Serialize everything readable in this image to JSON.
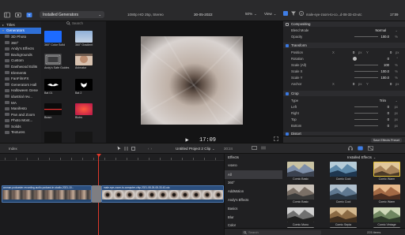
{
  "toolbar": {
    "library_menu": "Installed Generators",
    "format": "1080p HD 25p, Stereo",
    "date": "30-05-2022",
    "zoom": "50%",
    "view": "View",
    "clip_name": "male-eye-zoom-to-co...d-08-33-43-utc",
    "duration": "17:09"
  },
  "sidebar": {
    "items": [
      {
        "label": "Titles",
        "level": 0,
        "expanded": false
      },
      {
        "label": "Generators",
        "level": 0,
        "expanded": true,
        "selected": true
      },
      {
        "label": "3D Photo",
        "level": 1
      },
      {
        "label": "360°",
        "level": 1
      },
      {
        "label": "Andy's Effects",
        "level": 1
      },
      {
        "label": "Backgrounds",
        "level": 1
      },
      {
        "label": "Custom",
        "level": 1
      },
      {
        "label": "Dashwood Edits",
        "level": 1
      },
      {
        "label": "Elements",
        "level": 1
      },
      {
        "label": "FanFilmFX",
        "level": 1
      },
      {
        "label": "Generators Hall",
        "level": 1
      },
      {
        "label": "Halloween Gene",
        "level": 1
      },
      {
        "label": "idustrial rev...",
        "level": 1
      },
      {
        "label": "MA",
        "level": 1
      },
      {
        "label": "Manifesto",
        "level": 1
      },
      {
        "label": "Pan and Zoom",
        "level": 1
      },
      {
        "label": "Photo Mont...",
        "level": 1
      },
      {
        "label": "Solids",
        "level": 1
      },
      {
        "label": "Textures",
        "level": 1
      }
    ]
  },
  "browser": {
    "search_placeholder": "Search",
    "items": [
      {
        "label": "360° Color Solid",
        "style": "blue"
      },
      {
        "label": "360° Gradient",
        "style": "gradient"
      },
      {
        "label": "Andy's Safe Guides",
        "style": "grid"
      },
      {
        "label": "Animator",
        "style": "face"
      },
      {
        "label": "Bat 01",
        "style": "bat"
      },
      {
        "label": "Bat 2",
        "style": "bat2"
      },
      {
        "label": "Beam",
        "style": "beam"
      },
      {
        "label": "Blobs",
        "style": "blobs"
      },
      {
        "label": "",
        "style": "dark"
      },
      {
        "label": "",
        "style": "dark2"
      }
    ]
  },
  "viewer": {
    "timecode": "17:09"
  },
  "inspector": {
    "sections": [
      {
        "title": "Compositing",
        "checkbox": false
      },
      {
        "title": "Transform",
        "checkbox": true
      },
      {
        "title": "Crop",
        "checkbox": true
      },
      {
        "title": "Distort",
        "checkbox": true
      }
    ],
    "compositing": {
      "blend_mode_label": "Blend Mode",
      "blend_mode_value": "Normal",
      "opacity_label": "Opacity",
      "opacity_value": "100.0",
      "opacity_unit": "%"
    },
    "transform": {
      "position_label": "Position",
      "position_x_axis": "X",
      "position_x": "0",
      "position_x_unit": "px",
      "position_y_axis": "Y",
      "position_y": "0",
      "position_y_unit": "px",
      "rotation_label": "Rotation",
      "rotation_value": "0",
      "rotation_unit": "°",
      "scale_all_label": "Scale (All)",
      "scale_all_value": "100",
      "scale_all_unit": "%",
      "scale_x_label": "Scale X",
      "scale_x_value": "100.0",
      "scale_x_unit": "%",
      "scale_y_label": "Scale Y",
      "scale_y_value": "100.0",
      "scale_y_unit": "%",
      "anchor_label": "Anchor",
      "anchor_x_axis": "X",
      "anchor_x": "0",
      "anchor_x_unit": "px",
      "anchor_y_axis": "Y",
      "anchor_y": "0",
      "anchor_y_unit": "px"
    },
    "crop": {
      "type_label": "Type",
      "type_value": "Trim",
      "left_label": "Left",
      "left_value": "0",
      "left_unit": "px",
      "right_label": "Right",
      "right_value": "0",
      "right_unit": "px",
      "top_label": "Top",
      "top_value": "0",
      "top_unit": "px",
      "bottom_label": "Bottom",
      "bottom_value": "0",
      "bottom_unit": "px"
    },
    "save_preset": "Save Effects Preset"
  },
  "timeline": {
    "index_label": "Index",
    "project_name": "Untitled Project 2 Clip",
    "duration": "30:24",
    "clip1_label": "woman-podcaster-recording-audio-podcast-in-studio-2021-10...",
    "clip2_label": "male-eye-zoom-to-computer-chip-2021-08-26-08-33-43-utc"
  },
  "effects": {
    "header": "Effects",
    "installed": "Installed Effects",
    "categories": [
      "VIDEO",
      "All",
      "360°",
      "AddMotion",
      "Andy's Effects",
      "Basics",
      "Blur",
      "Color"
    ],
    "selected_category": "All",
    "items": [
      {
        "label": "Comic Basic"
      },
      {
        "label": "Comic Cool"
      },
      {
        "label": "Comic Warm"
      },
      {
        "label": "Comic Basic"
      },
      {
        "label": "Comic Cool"
      },
      {
        "label": "Comic Warm"
      },
      {
        "label": "Comic Mono"
      },
      {
        "label": "Comic Sepia"
      },
      {
        "label": "Comic Vintage"
      },
      {
        "label": ""
      },
      {
        "label": ""
      },
      {
        "label": ""
      }
    ],
    "search_placeholder": "Search",
    "count": "225 items"
  },
  "colors": {
    "accent": "#2f6fd6",
    "clip_blue": "#2c4f7e",
    "playhead": "#e0392b"
  }
}
